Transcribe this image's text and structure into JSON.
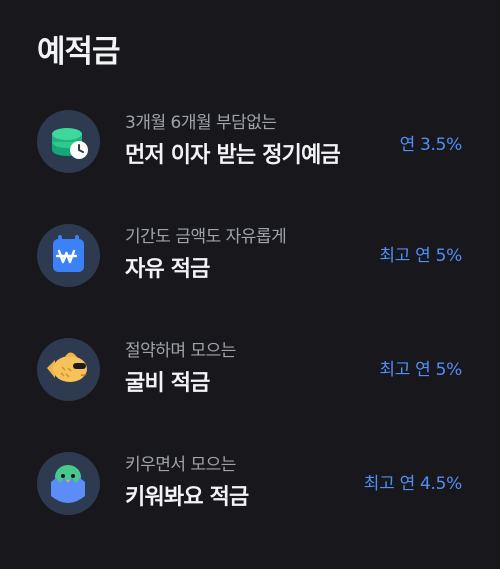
{
  "section": {
    "title": "예적금"
  },
  "products": [
    {
      "subtitle": "3개월 6개월 부담없는",
      "name": "먼저 이자 받는 정기예금",
      "rate": "연 3.5%",
      "icon": "coins-clock-icon"
    },
    {
      "subtitle": "기간도 금액도 자유롭게",
      "name": "자유 적금",
      "rate": "최고 연 5%",
      "icon": "won-calendar-icon"
    },
    {
      "subtitle": "절약하며 모으는",
      "name": "굴비 적금",
      "rate": "최고 연 5%",
      "icon": "fish-sunglasses-icon"
    },
    {
      "subtitle": "키우면서 모으는",
      "name": "키워봐요 적금",
      "rate": "최고 연 4.5%",
      "icon": "hatching-egg-icon"
    }
  ],
  "colors": {
    "background": "#18181c",
    "accent": "#4f8ef7",
    "icon_bg": "#2e3a50"
  }
}
